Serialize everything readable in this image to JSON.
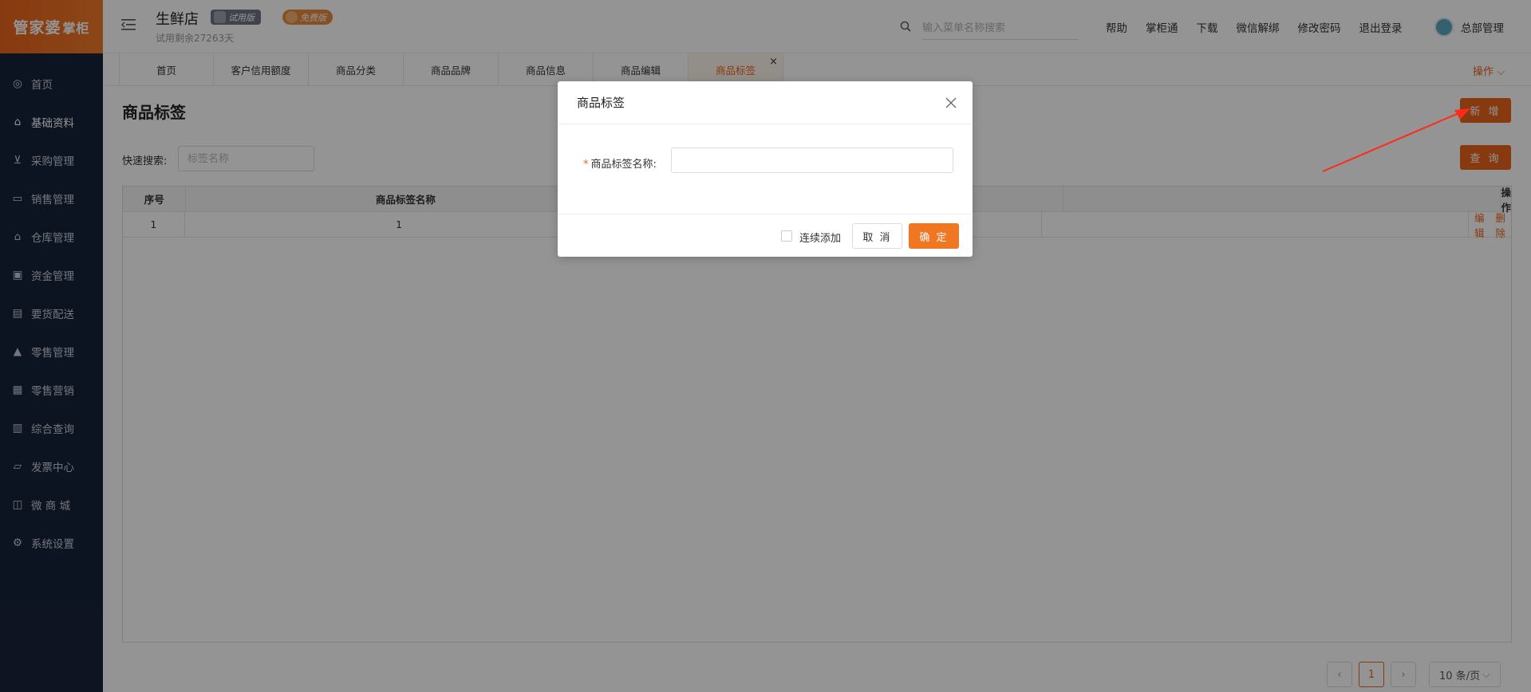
{
  "brand": {
    "logo_text": "管家婆",
    "logo_sub": "掌柜"
  },
  "header": {
    "store_name": "生鲜店",
    "trial_remaining": "试用剩余27263天",
    "badge_trial": "试用版",
    "badge_free": "免费版",
    "search_placeholder": "输入菜单名称搜索",
    "links": [
      "帮助",
      "掌柜通",
      "下载",
      "微信解绑",
      "修改密码",
      "退出登录"
    ],
    "user_name": "总部管理"
  },
  "sidebar": {
    "items": [
      {
        "label": "首页",
        "icon": "globe-icon"
      },
      {
        "label": "基础资料",
        "icon": "home-icon",
        "active": true
      },
      {
        "label": "采购管理",
        "icon": "cart-icon"
      },
      {
        "label": "销售管理",
        "icon": "sales-icon"
      },
      {
        "label": "仓库管理",
        "icon": "warehouse-icon"
      },
      {
        "label": "资金管理",
        "icon": "money-icon"
      },
      {
        "label": "要货配送",
        "icon": "delivery-icon"
      },
      {
        "label": "零售管理",
        "icon": "retail-chart-icon"
      },
      {
        "label": "零售营销",
        "icon": "gift-icon"
      },
      {
        "label": "综合查询",
        "icon": "bar-chart-icon"
      },
      {
        "label": "发票中心",
        "icon": "invoice-icon"
      },
      {
        "label": "微 商 城",
        "icon": "shop-bag-icon"
      },
      {
        "label": "系统设置",
        "icon": "gear-icon"
      }
    ]
  },
  "tabs": {
    "items": [
      "首页",
      "客户信用额度",
      "商品分类",
      "商品品牌",
      "商品信息",
      "商品编辑",
      "商品标签"
    ],
    "active_index": 6,
    "close_glyph": "×",
    "ops_label": "操作"
  },
  "main": {
    "title": "商品标签",
    "new_label": "新 增",
    "query_label": "查 询",
    "quick_search_label": "快速搜索:",
    "quick_search_placeholder": "标签名称",
    "table": {
      "headers": [
        "序号",
        "商品标签名称",
        "",
        "",
        "操作"
      ],
      "rows": [
        {
          "index": "1",
          "name": "1",
          "actions": [
            "编辑",
            "删除"
          ]
        }
      ]
    },
    "pager": {
      "prev": "‹",
      "page": "1",
      "next": "›",
      "page_size": "10 条/页"
    }
  },
  "modal": {
    "title": "商品标签",
    "field_label": "商品标签名称:",
    "required_mark": "*",
    "field_value": "",
    "continuous_label": "连续添加",
    "cancel_label": "取 消",
    "ok_label": "确 定"
  },
  "colors": {
    "accent": "#e9641a",
    "sidebar": "#18233a"
  }
}
